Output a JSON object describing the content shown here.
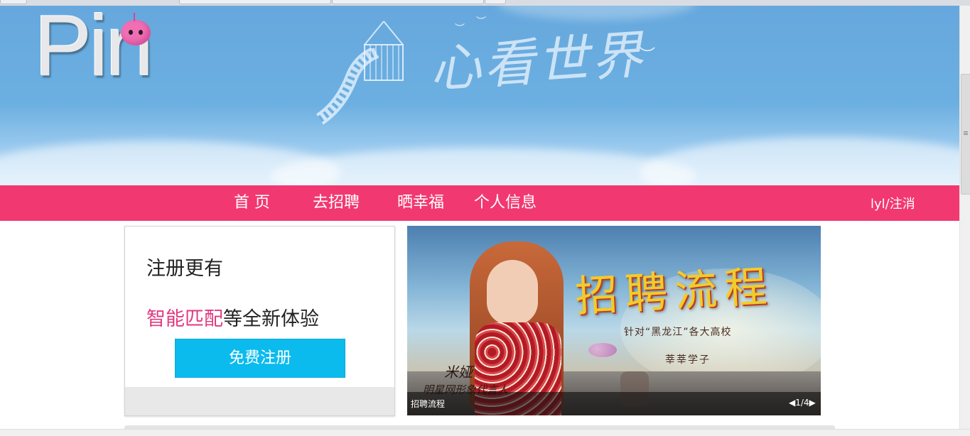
{
  "banner": {
    "logo_text": "Pin",
    "slogan": "心看世界"
  },
  "nav": {
    "items": [
      {
        "label": "首 页"
      },
      {
        "label": "去招聘"
      },
      {
        "label": "晒幸福"
      },
      {
        "label": "个人信息"
      }
    ],
    "user": "lyl/注消"
  },
  "register": {
    "headline": "注册更有",
    "sub_highlight": "智能匹配",
    "sub_rest": "等全新体验",
    "button_label": "免费注册"
  },
  "slideshow": {
    "title": "招聘流程",
    "line1": "针对“黑龙江”各大高校",
    "line2": "莘莘学子",
    "signature": "米娅",
    "signature_sub": "明星网形象代言人",
    "caption": "招聘流程",
    "pager": "1/4"
  },
  "colors": {
    "nav_bg": "#f23870",
    "button_bg": "#0bbbee",
    "highlight": "#e03a80",
    "banner_sky": "#6cafe1"
  }
}
